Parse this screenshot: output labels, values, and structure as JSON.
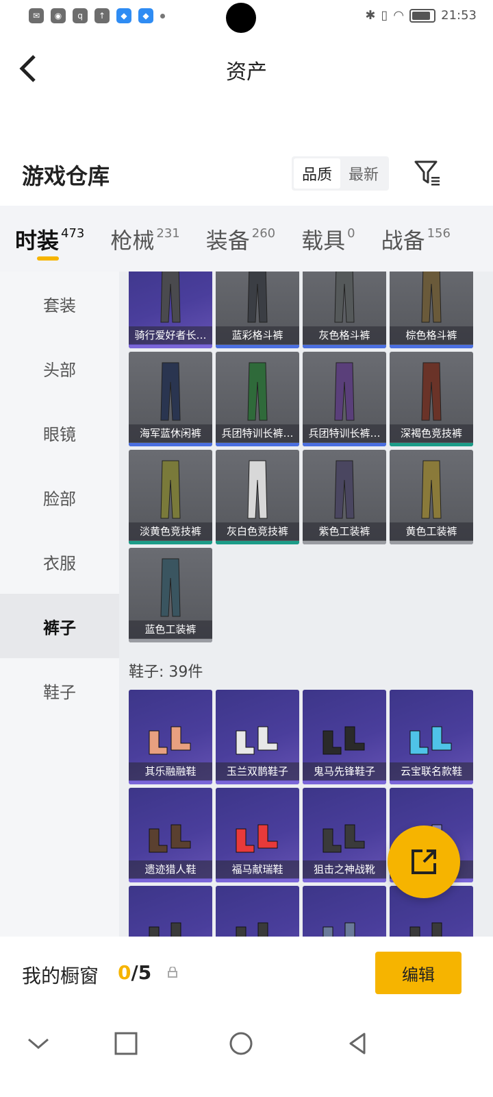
{
  "status": {
    "time": "21:53",
    "battery_level": 0.85
  },
  "header": {
    "title": "资产"
  },
  "warehouse": {
    "title": "游戏仓库",
    "sort": [
      "品质",
      "最新"
    ]
  },
  "tabs": [
    {
      "label": "时装",
      "count": "473"
    },
    {
      "label": "枪械",
      "count": "231"
    },
    {
      "label": "装备",
      "count": "260"
    },
    {
      "label": "载具",
      "count": "0"
    },
    {
      "label": "战备",
      "count": "156"
    }
  ],
  "sidebar": [
    "套装",
    "头部",
    "眼镜",
    "脸部",
    "衣服",
    "裤子",
    "鞋子"
  ],
  "pants": [
    {
      "name": "骑行爱好者长…",
      "style": "purple",
      "bar": "purp"
    },
    {
      "name": "蓝彩格斗裤",
      "style": "grey",
      "bar": "blue"
    },
    {
      "name": "灰色格斗裤",
      "style": "grey",
      "bar": "blue"
    },
    {
      "name": "棕色格斗裤",
      "style": "grey",
      "bar": "blue"
    },
    {
      "name": "海军蓝休闲裤",
      "style": "grey",
      "bar": "blue"
    },
    {
      "name": "兵团特训长裤…",
      "style": "grey",
      "bar": "blue"
    },
    {
      "name": "兵团特训长裤…",
      "style": "grey",
      "bar": "blue"
    },
    {
      "name": "深褐色竞技裤",
      "style": "grey",
      "bar": "teal"
    },
    {
      "name": "淡黄色竞技裤",
      "style": "grey",
      "bar": "teal"
    },
    {
      "name": "灰白色竞技裤",
      "style": "grey",
      "bar": "teal"
    },
    {
      "name": "紫色工装裤",
      "style": "grey",
      "bar": "gray"
    },
    {
      "name": "黄色工装裤",
      "style": "grey",
      "bar": "gray"
    },
    {
      "name": "蓝色工装裤",
      "style": "grey",
      "bar": "gray"
    }
  ],
  "shoes_section": "鞋子: 39件",
  "shoes": [
    {
      "name": "其乐融融鞋"
    },
    {
      "name": "玉兰双鹊鞋子"
    },
    {
      "name": "鬼马先锋鞋子"
    },
    {
      "name": "云宝联名款鞋"
    },
    {
      "name": "遗迹猎人鞋"
    },
    {
      "name": "福马献瑞鞋"
    },
    {
      "name": "狙击之神战靴"
    },
    {
      "name": ""
    },
    {
      "name": ""
    },
    {
      "name": ""
    },
    {
      "name": ""
    },
    {
      "name": ""
    }
  ],
  "showcase": {
    "title": "我的橱窗",
    "used": "0",
    "total": "/5",
    "edit": "编辑"
  },
  "colors": {
    "accent": "#f6b400",
    "rare_purple": "#4a3e9c"
  }
}
